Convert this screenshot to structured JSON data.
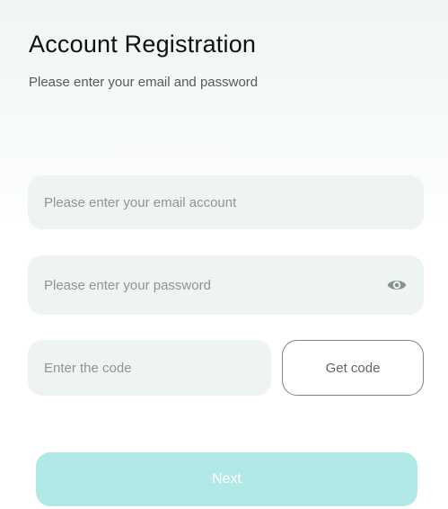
{
  "header": {
    "title": "Account Registration",
    "subtitle": "Please enter your email and password"
  },
  "form": {
    "email": {
      "placeholder": "Please enter your email account",
      "value": ""
    },
    "password": {
      "placeholder": "Please enter your password",
      "value": "",
      "toggle_icon": "eye-icon"
    },
    "code": {
      "placeholder": "Enter the code",
      "value": ""
    },
    "get_code_label": "Get code",
    "next_label": "Next"
  },
  "colors": {
    "field_background": "#eef4f3",
    "next_button_background": "#b0e9e6",
    "next_button_text": "#ffffff",
    "title_text": "#111111",
    "get_code_border": "#7d8382"
  }
}
